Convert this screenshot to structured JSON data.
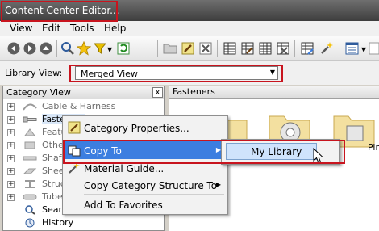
{
  "window": {
    "title": "Content Center Editor..."
  },
  "menu": [
    "View",
    "Edit",
    "Tools",
    "Help"
  ],
  "toolbar": {
    "icons": [
      "back-icon",
      "forward-icon",
      "search-icon",
      "favorites-icon",
      "filter-icon",
      "refresh-icon",
      "new-folder-icon",
      "edit-icon",
      "delete-icon",
      "table-icon",
      "table-edit-icon",
      "publish-icon",
      "view-options-icon"
    ]
  },
  "library": {
    "label": "Library View:",
    "value": "Merged View"
  },
  "left_panel": {
    "title": "Category View",
    "close": "x",
    "tree": [
      {
        "label": "Cable & Harness",
        "grey": true,
        "icon": "cable-icon"
      },
      {
        "label": "Fasteners",
        "grey": false,
        "icon": "fastener-icon"
      },
      {
        "label": "Featu",
        "grey": true,
        "icon": "feature-icon"
      },
      {
        "label": "Othe",
        "grey": true,
        "icon": "other-icon"
      },
      {
        "label": "Shaf",
        "grey": true,
        "icon": "shaft-icon"
      },
      {
        "label": "Sheet",
        "grey": true,
        "icon": "sheet-icon"
      },
      {
        "label": "Struc",
        "grey": true,
        "icon": "structural-icon"
      },
      {
        "label": "Tube",
        "grey": true,
        "icon": "tube-icon"
      },
      {
        "label": "Searc",
        "grey": false,
        "icon": "search-icon"
      },
      {
        "label": "History",
        "grey": false,
        "icon": "history-icon"
      }
    ]
  },
  "right_panel": {
    "title": "Fasteners",
    "partial_item": "Pin"
  },
  "context_menu": [
    {
      "label": "Category Properties...",
      "icon": "properties-icon",
      "submenu": false
    },
    {
      "label": "Copy To",
      "icon": "copy-icon",
      "submenu": true,
      "highlighted": true
    },
    {
      "label": "Material Guide...",
      "icon": "material-icon",
      "submenu": false
    },
    {
      "label": "Copy Category Structure To",
      "icon": "",
      "submenu": true
    },
    {
      "label": "Add To Favorites",
      "icon": "",
      "submenu": false
    }
  ],
  "sub_menu": {
    "item": "My Library"
  },
  "colors": {
    "highlight": "#3c7ee0",
    "annotation": "#c8141e",
    "title_bar": "#3d3d3d"
  }
}
